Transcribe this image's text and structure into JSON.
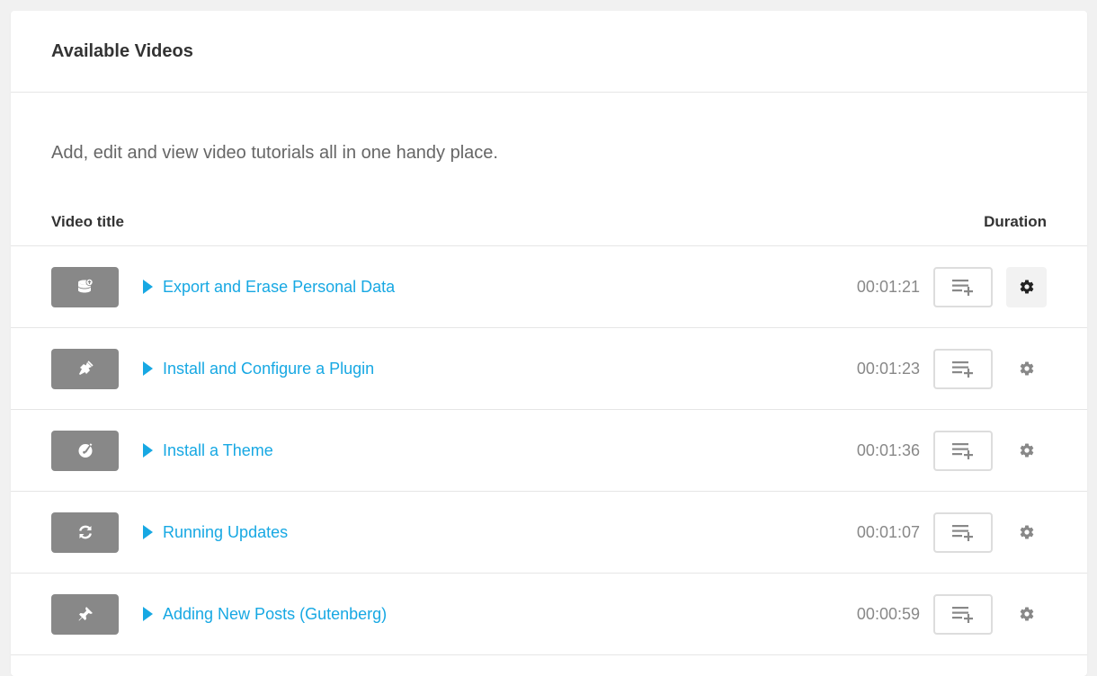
{
  "panel": {
    "title": "Available Videos",
    "description": "Add, edit and view video tutorials all in one handy place."
  },
  "table": {
    "col_title": "Video title",
    "col_duration": "Duration"
  },
  "videos": [
    {
      "title": "Export and Erase Personal Data",
      "duration": "00:01:21",
      "icon": "database-export-icon"
    },
    {
      "title": "Install and Configure a Plugin",
      "duration": "00:01:23",
      "icon": "plugin-icon"
    },
    {
      "title": "Install a Theme",
      "duration": "00:01:36",
      "icon": "theme-brush-icon"
    },
    {
      "title": "Running Updates",
      "duration": "00:01:07",
      "icon": "refresh-icon"
    },
    {
      "title": "Adding New Posts (Gutenberg)",
      "duration": "00:00:59",
      "icon": "pin-icon"
    }
  ],
  "colors": {
    "link": "#17a8e3",
    "thumb_bg": "#888888",
    "gear_active_bg": "#f2f2f2"
  }
}
